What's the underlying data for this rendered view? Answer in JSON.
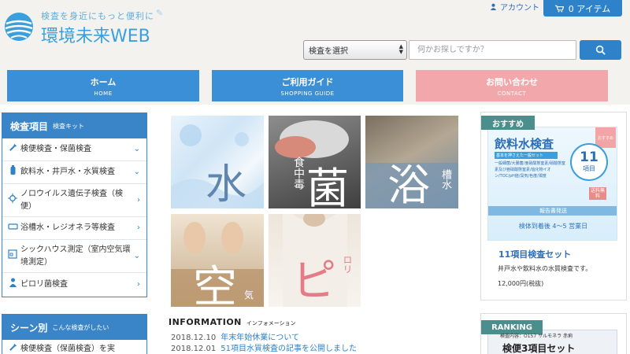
{
  "header": {
    "tagline": "検査を身近にもっと便利に",
    "site_title": "環境未来WEB",
    "account_label": "アカウント",
    "cart_label": "0 アイテム",
    "select_value": "検査を選択",
    "search_placeholder": "何かお探しですか？"
  },
  "nav": {
    "home": {
      "jp": "ホーム",
      "en": "HOME"
    },
    "guide": {
      "jp": "ご利用ガイド",
      "en": "SHOPPING GUIDE"
    },
    "contact": {
      "jp": "お問い合わせ",
      "en": "CONTACT"
    }
  },
  "sidebar": {
    "inspection": {
      "title": "検査項目",
      "subtitle": "検査キット",
      "items": [
        {
          "label": "検便検査・保菌検査",
          "icon": "dropper-icon",
          "arrow": "chevron-down"
        },
        {
          "label": "飲料水・井戸水・水質検査",
          "icon": "water-bottle-icon",
          "arrow": "chevron-down"
        },
        {
          "label": "ノロウイルス遺伝子検査（検便）",
          "icon": "virus-icon",
          "arrow": "chevron-right"
        },
        {
          "label": "浴槽水・レジオネラ等検査",
          "icon": "bathtub-icon",
          "arrow": "chevron-right"
        },
        {
          "label": "シックハウス測定（室内空気環境測定）",
          "icon": "house-icon",
          "arrow": "chevron-down"
        },
        {
          "label": "ピロリ菌検査",
          "icon": "person-icon",
          "arrow": "chevron-right"
        }
      ]
    },
    "scene": {
      "title": "シーン別",
      "subtitle": "こんな検査がしたい",
      "items": [
        {
          "label": "検便検査（保菌検査）を実",
          "icon": "dropper-icon"
        }
      ]
    }
  },
  "tiles": {
    "water": {
      "main": "水"
    },
    "bacteria": {
      "side": "食中毒",
      "main": "菌"
    },
    "bath": {
      "main": "浴",
      "side": "槽水"
    },
    "air": {
      "main": "空",
      "side": "気"
    },
    "pylori": {
      "main": "ピ",
      "side": "ロリ"
    }
  },
  "information": {
    "title": "INFORMATION",
    "subtitle": "インフォメーション",
    "news": [
      {
        "date": "2018.12.10",
        "text": "年末年始休業について"
      },
      {
        "date": "2018.12.01",
        "text": "51項目水質検査の記事を公開しました"
      }
    ]
  },
  "recommend": {
    "label": "おすすめ",
    "image_title": "飲料水検査",
    "image_badge": "おすすめ",
    "image_count": "11",
    "image_unit": "項目",
    "image_subtitle": "基本を押さえた一般セット",
    "image_items": "一般細菌/大腸菌/亜硝酸態窒素/硝酸態窒素及び亜硝酸態窒素/塩化物イオン/TOC/pH値/臭気/色度/濁度",
    "image_free": "送料無料",
    "image_report": "報告書発送",
    "image_days": "検体到着後 4～5 営業日",
    "name": "11項目検査セット",
    "desc": "井戸水や飲料水の水質検査です。",
    "price": "12,000円(税抜)"
  },
  "ranking": {
    "label": "RANKING",
    "image_sub": "検査内容：O157 サルモネラ 赤痢",
    "image_name": "検便3項目セット"
  },
  "colors": {
    "accent_blue": "#2e82c9",
    "nav_blue": "#3b8fd6",
    "contact_pink": "#f2a7ab",
    "label_teal": "#4b8f8c"
  }
}
